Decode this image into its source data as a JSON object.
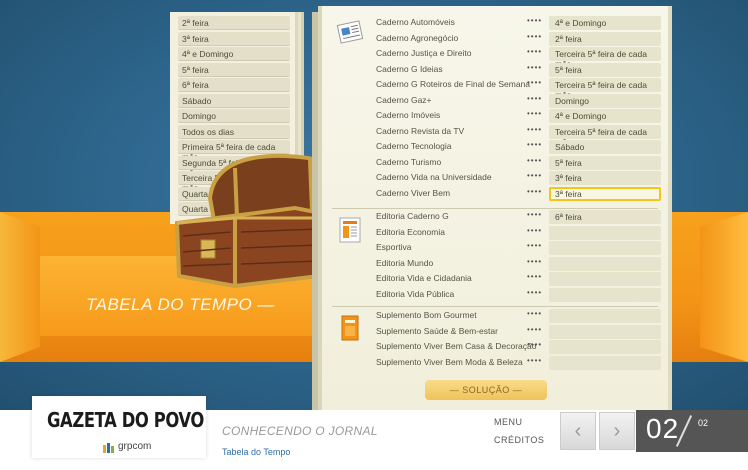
{
  "band_title": "TABELA DO TEMPO —",
  "day_options": [
    "2ª feira",
    "3ª feira",
    "4ª e Domingo",
    "5ª feira",
    "6ª feira",
    "Sábado",
    "Domingo",
    "Todos os dias",
    "Primeira 5ª feira de cada mês",
    "Segunda 5ª feira de cada mês",
    "Terceira 5ª feira de cada mês",
    "Quarta 5ª feira de cada mês",
    "Quarta 4ª feira de cada mês"
  ],
  "caderno_rows": [
    {
      "label": "Caderno Automóveis",
      "answer": "4ª e Domingo"
    },
    {
      "label": "Caderno Agronegócio",
      "answer": "2ª feira"
    },
    {
      "label": "Caderno Justiça e Direito",
      "answer": "Terceira 5ª feira de cada mês"
    },
    {
      "label": "Caderno G Ideias",
      "answer": "5ª feira"
    },
    {
      "label": "Caderno G Roteiros de Final de Semana",
      "answer": "Terceira 5ª feira de cada mês"
    },
    {
      "label": "Caderno Gaz+",
      "answer": "Domingo"
    },
    {
      "label": "Caderno Imóveis",
      "answer": "4ª e Domingo"
    },
    {
      "label": "Caderno Revista da TV",
      "answer": "Terceira 5ª feira de cada mês"
    },
    {
      "label": "Caderno Tecnologia",
      "answer": "Sábado"
    },
    {
      "label": "Caderno Turismo",
      "answer": "5ª feira"
    },
    {
      "label": "Caderno Vida na Universidade",
      "answer": "3ª feira"
    },
    {
      "label": "Caderno Viver Bem",
      "answer": "3ª feira"
    }
  ],
  "editoria_rows": [
    {
      "label": "Editoria Caderno G",
      "answer": "6ª feira"
    },
    {
      "label": "Editoria Economia",
      "answer": ""
    },
    {
      "label": "Esportiva",
      "answer": ""
    },
    {
      "label": "Editoria Mundo",
      "answer": ""
    },
    {
      "label": "Editoria Vida e Cidadania",
      "answer": ""
    },
    {
      "label": "Editoria Vida Pública",
      "answer": ""
    }
  ],
  "suplemento_rows": [
    {
      "label": "Suplemento Bom Gourmet",
      "answer": ""
    },
    {
      "label": "Suplemento Saúde & Bem-estar",
      "answer": ""
    },
    {
      "label": "Suplemento Viver Bem Casa & Decoração",
      "answer": ""
    },
    {
      "label": "Suplemento Viver Bem Moda & Beleza",
      "answer": ""
    }
  ],
  "dots": "••••",
  "solution_button": "— SOLUÇÃO —",
  "footer": {
    "logo": "GAZETA DO POVO",
    "brand": "grpcom",
    "section_title": "CONHECENDO O JORNAL",
    "subtitle": "Tabela do Tempo",
    "menu": "MENU",
    "credits": "CRÉDITOS",
    "prev_icon": "chevron-left-icon",
    "next_icon": "chevron-right-icon",
    "page_current": "02",
    "page_total": "02"
  },
  "colors": {
    "accent_orange": "#f39417",
    "selected_border": "#f5c518",
    "link_blue": "#2c6fa8"
  }
}
